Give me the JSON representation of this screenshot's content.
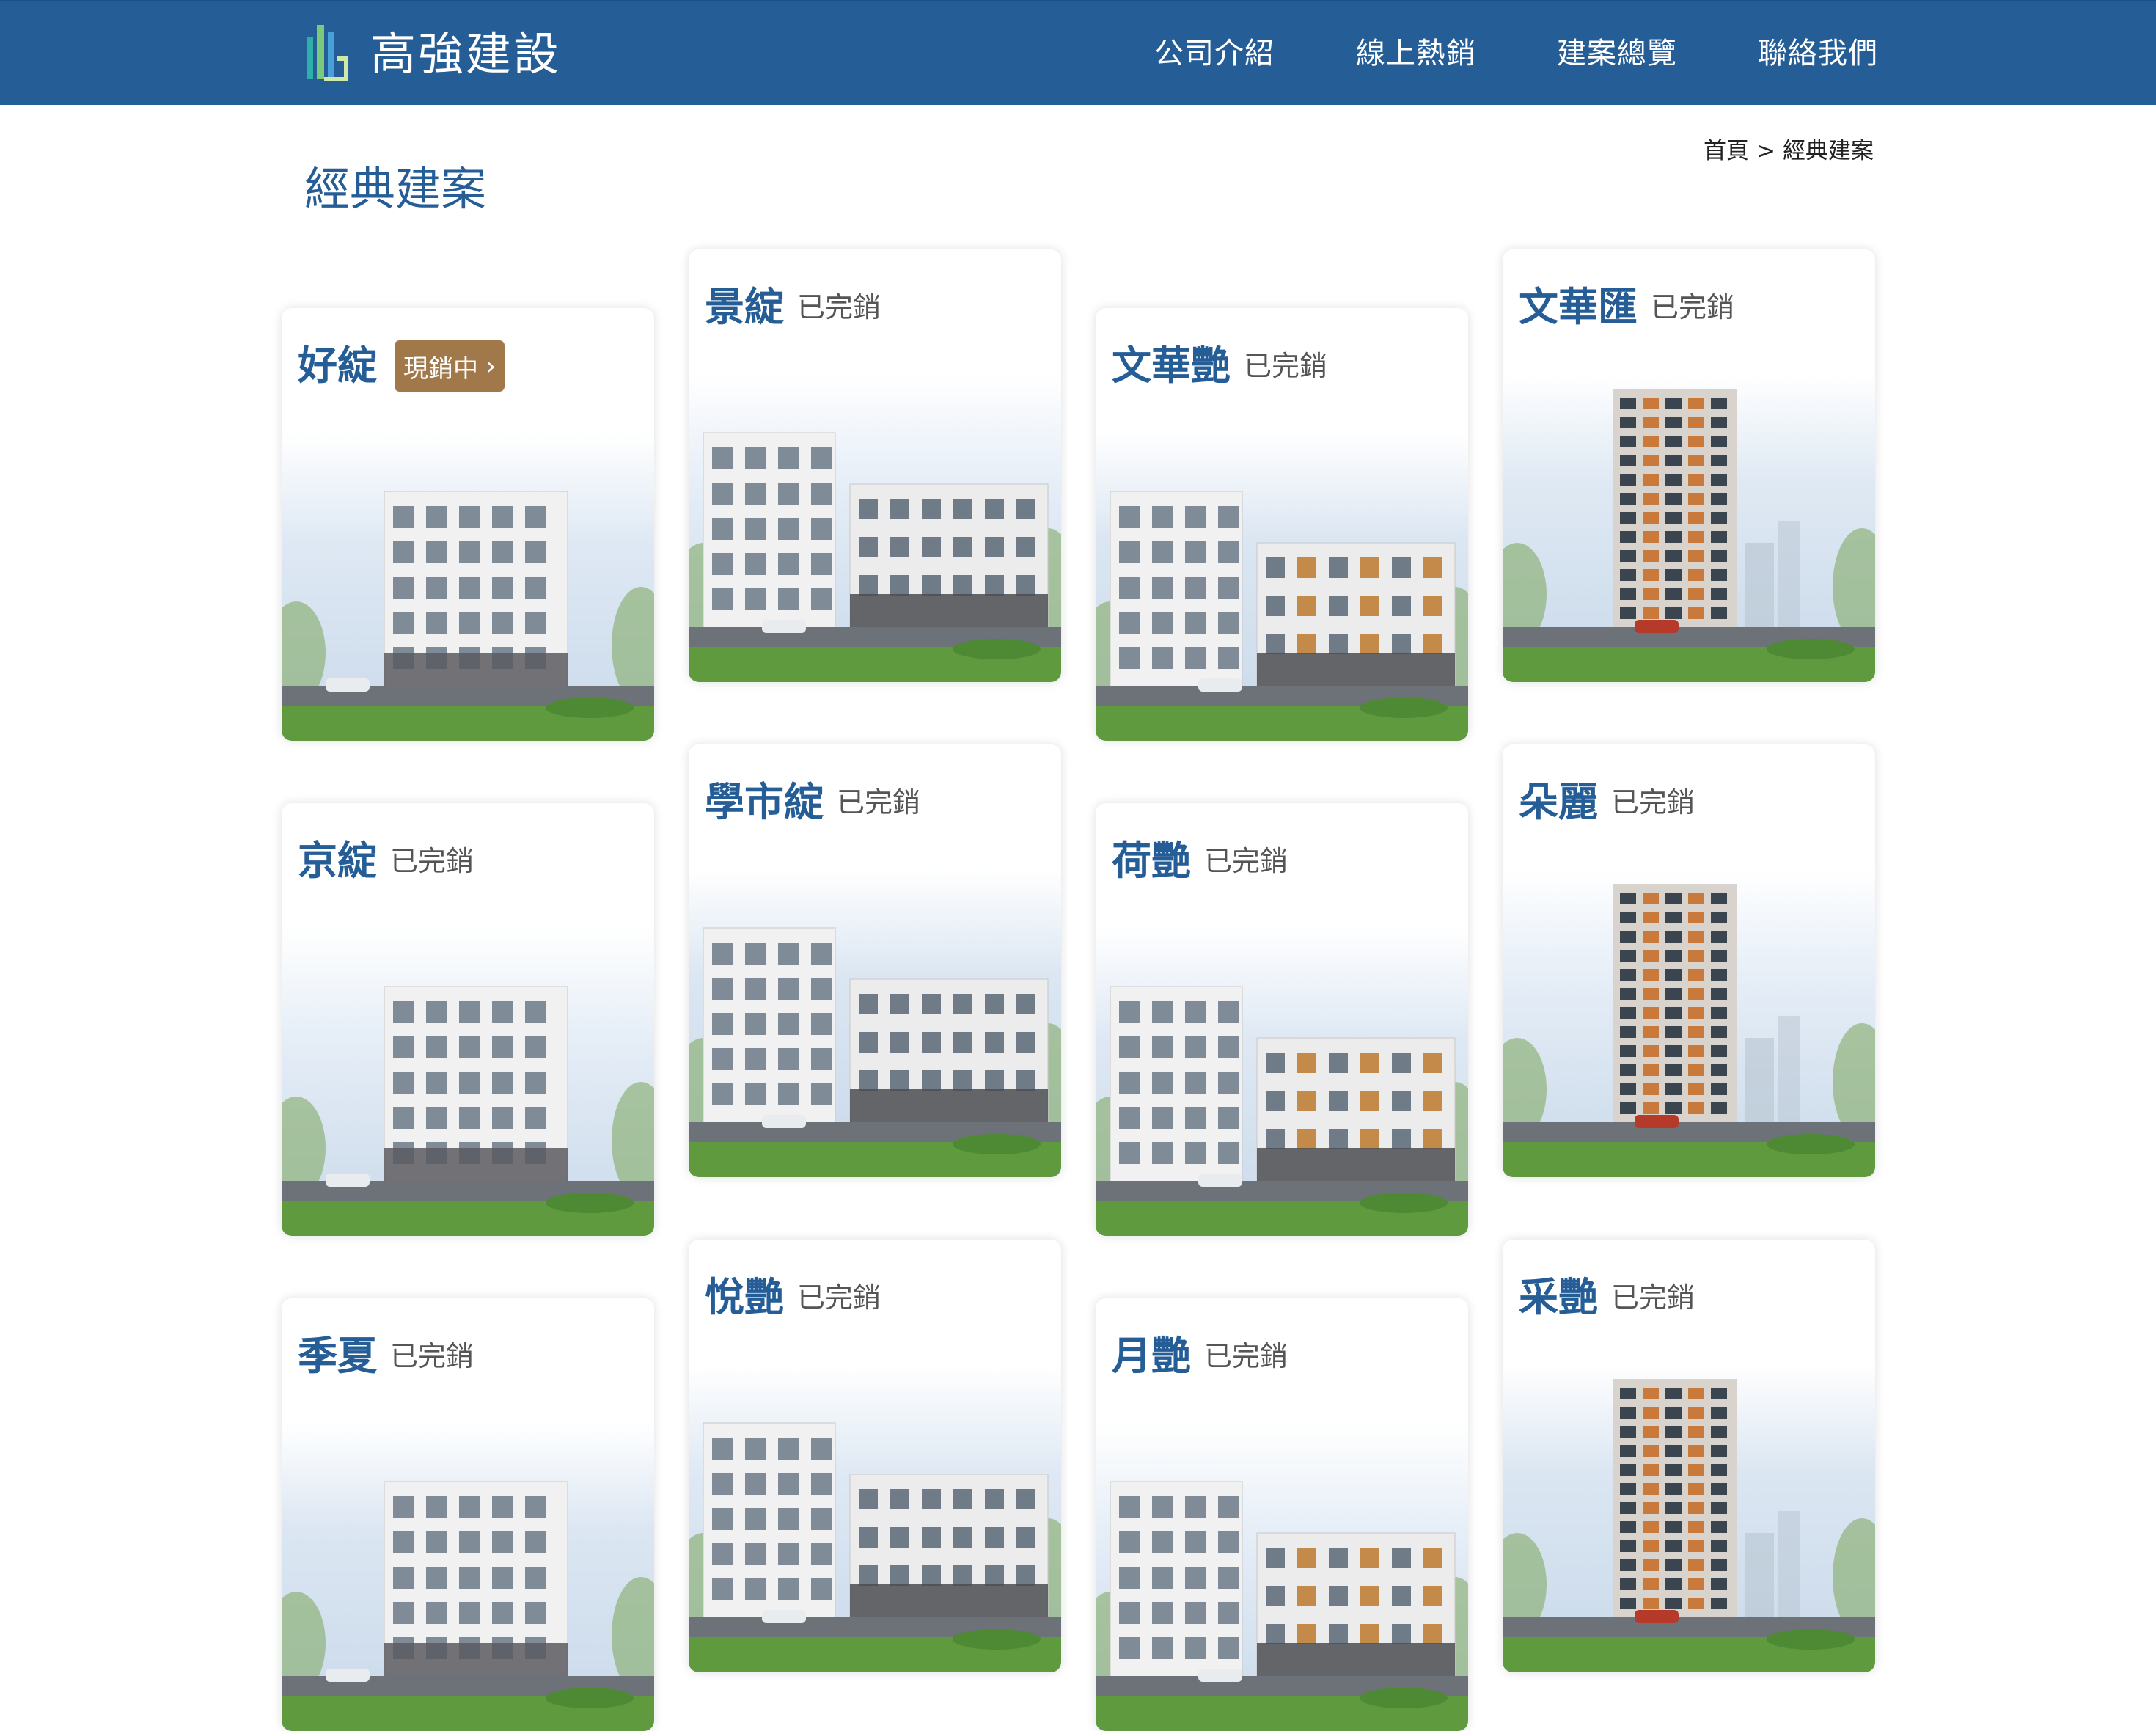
{
  "header": {
    "brand": "高強建設",
    "nav": [
      "公司介紹",
      "線上熱銷",
      "建案總覽",
      "聯絡我們"
    ]
  },
  "page": {
    "title": "經典建案",
    "breadcrumb": {
      "home": "首頁",
      "separator": ">",
      "current": "經典建案"
    }
  },
  "projects": [
    {
      "name": "好綻",
      "status": "現銷中",
      "selling": true
    },
    {
      "name": "景綻",
      "status": "已完銷"
    },
    {
      "name": "文華艷",
      "status": "已完銷"
    },
    {
      "name": "文華匯",
      "status": "已完銷"
    },
    {
      "name": "京綻",
      "status": "已完銷"
    },
    {
      "name": "學市綻",
      "status": "已完銷"
    },
    {
      "name": "荷艷",
      "status": "已完銷"
    },
    {
      "name": "朵麗",
      "status": "已完銷"
    },
    {
      "name": "季夏",
      "status": "已完銷"
    },
    {
      "name": "悅艷",
      "status": "已完銷"
    },
    {
      "name": "月艷",
      "status": "已完銷"
    },
    {
      "name": "采艷",
      "status": "已完銷"
    }
  ],
  "colors": {
    "header": "#255d97",
    "accent": "#255d97",
    "badge": "#a0784a"
  }
}
